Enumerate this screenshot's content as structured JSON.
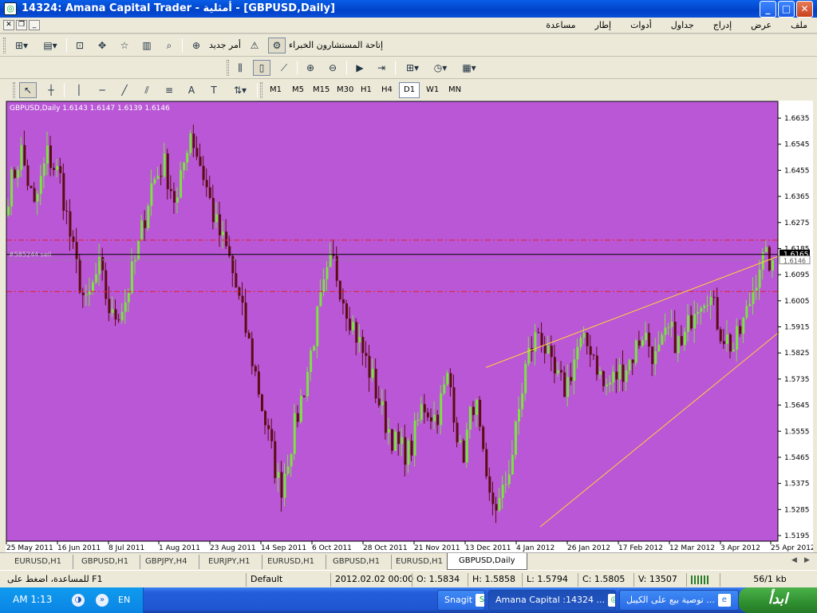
{
  "window": {
    "title": "14324: Amana Capital Trader - أمثلية - [GBPUSD,Daily]"
  },
  "menu": {
    "items": [
      "ملف",
      "عرض",
      "إدراج",
      "جداول",
      "أدوات",
      "إطار",
      "مساعدة"
    ]
  },
  "toolbar1": {
    "new_order": "أمر جديد",
    "experts": "إتاحة المستشارون الخبراء"
  },
  "toolbar3": {
    "timeframes": [
      "M1",
      "M5",
      "M15",
      "M30",
      "H1",
      "H4",
      "D1",
      "W1",
      "MN"
    ],
    "active": "D1"
  },
  "chart": {
    "header": "GBPUSD,Daily  1.6143 1.6147 1.6139 1.6146",
    "order_label": "#585244 sell",
    "price_marker": "1.6165",
    "bid_marker": "1.6146",
    "background": "#b957d6",
    "bull_color": "#7be342",
    "bear_color": "#5a0c12",
    "level_color": "#e0232b",
    "trend_color": "#ffd23a",
    "y_labels": [
      "1.6635",
      "1.6545",
      "1.6455",
      "1.6365",
      "1.6275",
      "1.6185",
      "1.6095",
      "1.6005",
      "1.5915",
      "1.5825",
      "1.5735",
      "1.5645",
      "1.5555",
      "1.5465",
      "1.5375",
      "1.5285",
      "1.5195"
    ],
    "x_labels": [
      "25 May 2011",
      "16 Jun 2011",
      "8 Jul 2011",
      "1 Aug 2011",
      "23 Aug 2011",
      "14 Sep 2011",
      "6 Oct 2011",
      "28 Oct 2011",
      "21 Nov 2011",
      "13 Dec 2011",
      "4 Jan 2012",
      "26 Jan 2012",
      "17 Feb 2012",
      "12 Mar 2012",
      "3 Apr 2012",
      "25 Apr 2012"
    ],
    "price_waypoints": [
      1.638,
      1.652,
      1.632,
      1.651,
      1.643,
      1.617,
      1.598,
      1.612,
      1.594,
      1.6,
      1.618,
      1.64,
      1.648,
      1.633,
      1.66,
      1.645,
      1.627,
      1.616,
      1.597,
      1.577,
      1.555,
      1.535,
      1.555,
      1.574,
      1.598,
      1.615,
      1.6,
      1.587,
      1.575,
      1.56,
      1.55,
      1.548,
      1.565,
      1.56,
      1.575,
      1.545,
      1.568,
      1.532,
      1.53,
      1.55,
      1.58,
      1.591,
      1.575,
      1.57,
      1.585,
      1.585,
      1.57,
      1.575,
      1.58,
      1.59,
      1.58,
      1.59,
      1.584,
      1.6,
      1.604,
      1.59,
      1.584,
      1.596,
      1.614,
      1.6146
    ]
  },
  "tabs": {
    "items": [
      "EURUSD,H1",
      "GBPUSD,H1",
      "GBPJPY,H4",
      "EURJPY,H1",
      "EURUSD,H1",
      "GBPUSD,H1",
      "EURUSD,H1",
      "GBPUSD,Daily"
    ],
    "active": "GBPUSD,Daily"
  },
  "status": {
    "help": "للمساعدة، اضغط على F1",
    "profile": "Default",
    "datetime": "2012.02.02 00:00",
    "open": "O: 1.5834",
    "high": "H: 1.5858",
    "low": "L: 1.5794",
    "close": "C: 1.5805",
    "volume": "V: 13507",
    "traffic": "56/1 kb"
  },
  "taskbar": {
    "clock": "AM 1:13",
    "lang": "EN",
    "snagit": "Snagit",
    "amana": "Amana Capital :14324 ...",
    "note": "توصية بيع على الكيبل ...",
    "start": "ابدأ"
  }
}
